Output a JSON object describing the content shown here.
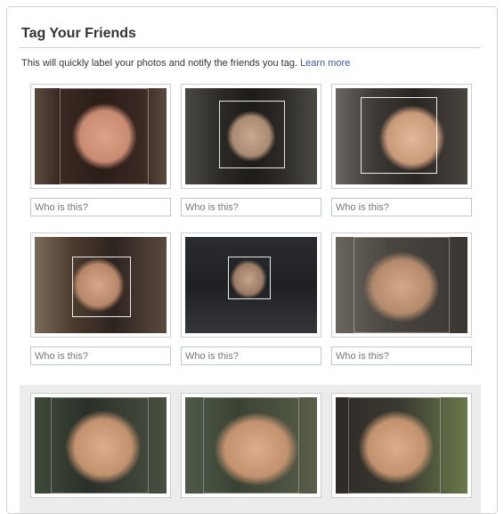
{
  "dialog": {
    "title": "Tag Your Friends",
    "subtitle": "This will quickly label your photos and notify the friends you tag.",
    "learn_more": "Learn more"
  },
  "photos": [
    {
      "name": "photo-1",
      "input_placeholder": "Who is this?"
    },
    {
      "name": "photo-2",
      "input_placeholder": "Who is this?"
    },
    {
      "name": "photo-3",
      "input_placeholder": "Who is this?"
    },
    {
      "name": "photo-4",
      "input_placeholder": "Who is this?"
    },
    {
      "name": "photo-5",
      "input_placeholder": "Who is this?"
    },
    {
      "name": "photo-6",
      "input_placeholder": "Who is this?"
    },
    {
      "name": "photo-7"
    },
    {
      "name": "photo-8"
    },
    {
      "name": "photo-9"
    }
  ],
  "colors": {
    "link": "#3b5998",
    "border": "#cccccc",
    "input_border": "#bdc7d8",
    "band": "#ececec"
  }
}
